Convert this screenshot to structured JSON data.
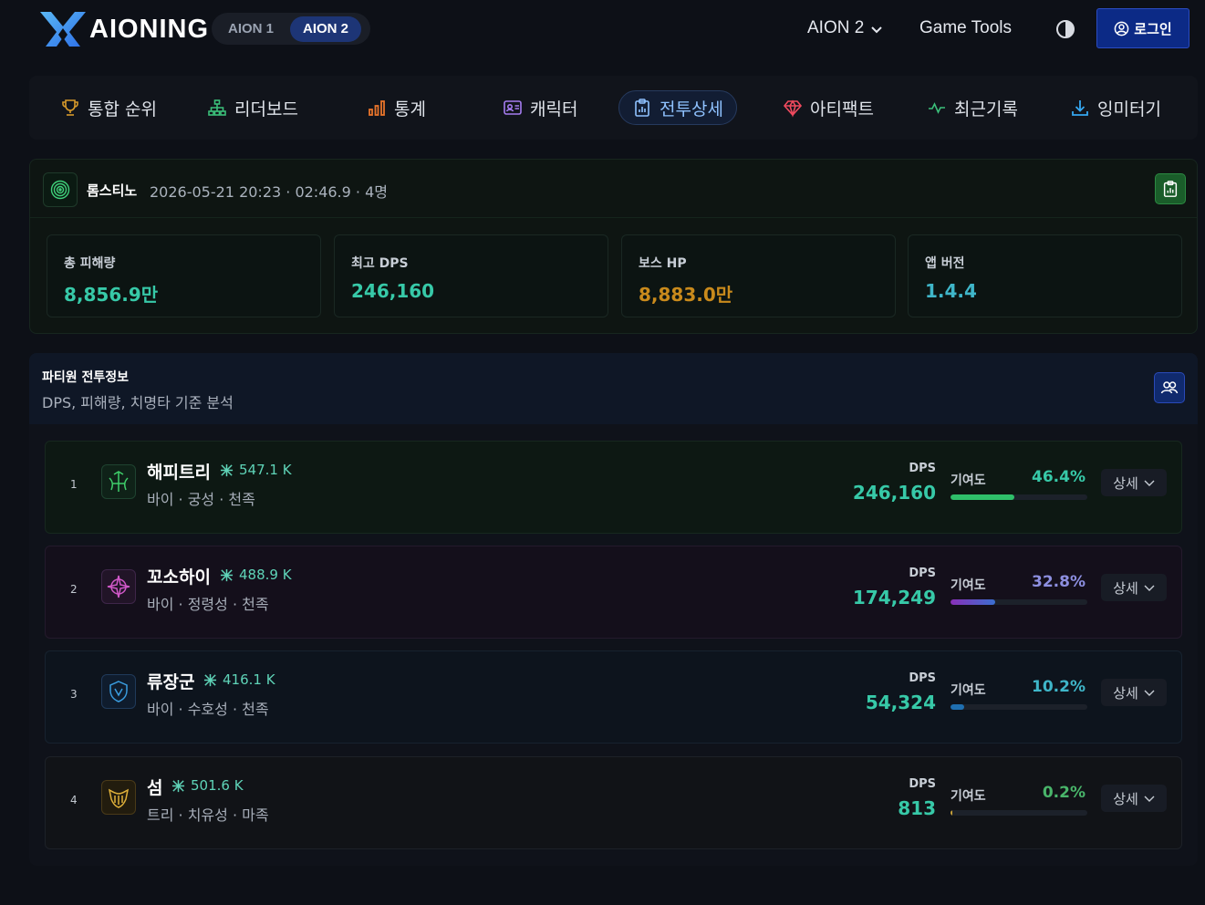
{
  "header": {
    "logo_text": "AIONING",
    "versions": [
      "AION 1",
      "AION 2"
    ],
    "active_version": "AION 2",
    "game_menu": "AION 2",
    "game_tools": "Game Tools",
    "login": "로그인"
  },
  "tabs": [
    {
      "label": "통합 순위",
      "icon": "trophy-icon"
    },
    {
      "label": "리더보드",
      "icon": "hierarchy-icon"
    },
    {
      "label": "통계",
      "icon": "bar-chart-icon"
    },
    {
      "label": "캐릭터",
      "icon": "id-card-icon"
    },
    {
      "label": "전투상세",
      "icon": "clipboard-chart-icon",
      "active": true
    },
    {
      "label": "아티팩트",
      "icon": "gem-icon"
    },
    {
      "label": "최근기록",
      "icon": "activity-icon"
    },
    {
      "label": "잉미터기",
      "icon": "download-icon"
    }
  ],
  "battle": {
    "dungeon": "롬스티노",
    "meta": "2026-05-21 20:23 · 02:46.9 · 4명",
    "stats": [
      {
        "label": "총 피해량",
        "value": "8,856.9만",
        "color": "#37c9a8"
      },
      {
        "label": "최고 DPS",
        "value": "246,160",
        "color": "#37c9a8"
      },
      {
        "label": "보스 HP",
        "value": "8,883.0만",
        "color": "#c98a1c"
      },
      {
        "label": "앱 버전",
        "value": "1.4.4",
        "color": "#3fb6c9"
      }
    ]
  },
  "party": {
    "title": "파티원 전투정보",
    "subtitle": "DPS, 피해량, 치명타 기준 분석",
    "dps_label": "DPS",
    "contrib_label": "기여도",
    "detail_label": "상세",
    "members": [
      {
        "rank": "1",
        "name": "해피트리",
        "score": "547.1 K",
        "info": "바이 · 궁성 · 천족",
        "dps": "246,160",
        "contribution": "46.4%",
        "contribution_value": 46.4,
        "accent": "#2fbf6a",
        "pct_color": "#37c9a8",
        "icon": "bow-class-icon"
      },
      {
        "rank": "2",
        "name": "꼬소하이",
        "score": "488.9 K",
        "info": "바이 · 정령성 · 천족",
        "dps": "174,249",
        "contribution": "32.8%",
        "contribution_value": 32.8,
        "accent": "#b04fd0",
        "pct_color": "#8d8fe0",
        "icon": "spirit-class-icon"
      },
      {
        "rank": "3",
        "name": "류장군",
        "score": "416.1 K",
        "info": "바이 · 수호성 · 천족",
        "dps": "54,324",
        "contribution": "10.2%",
        "contribution_value": 10.2,
        "accent": "#2a8fd0",
        "pct_color": "#3fb6c9",
        "icon": "shield-class-icon"
      },
      {
        "rank": "4",
        "name": "섬",
        "score": "501.6 K",
        "info": "트리 · 치유성 · 마족",
        "dps": "813",
        "contribution": "0.2%",
        "contribution_value": 0.2,
        "accent": "#d4a22b",
        "pct_color": "#49b56a",
        "icon": "healer-class-icon"
      }
    ]
  }
}
